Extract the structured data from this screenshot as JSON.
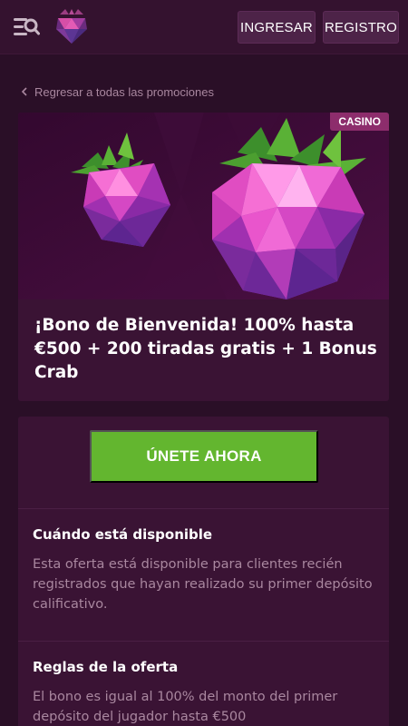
{
  "header": {
    "login_label": "INGRESAR",
    "register_label": "REGISTRO",
    "icons": {
      "menu": "menu-search-icon",
      "logo": "raspberry-logo-icon"
    }
  },
  "back_link": {
    "label": "Regresar a todas las promociones",
    "icon": "chevron-left-icon"
  },
  "promo": {
    "badge": "CASINO",
    "title": "¡Bono de Bienvenida! 100% hasta €500 + 200 tiradas gratis + 1 Bonus Crab",
    "image_icon": "raspberry-gems-illustration"
  },
  "details": {
    "join_label": "ÚNETE AHORA",
    "availability": {
      "heading": "Cuándo está disponible",
      "body": "Esta oferta está disponible para clientes recién registrados que hayan realizado su primer depósito calificativo."
    },
    "rules": {
      "heading": "Reglas de la oferta",
      "body": "El bono es igual al 100% del monto del primer depósito del jugador hasta €500"
    }
  },
  "colors": {
    "background": "#2a0f27",
    "header": "#34122f",
    "card": "#3a1334",
    "button_dark": "#4d2348",
    "badge": "#8d2d6c",
    "join_button": "#63b62f",
    "muted_text": "#a9879f"
  }
}
